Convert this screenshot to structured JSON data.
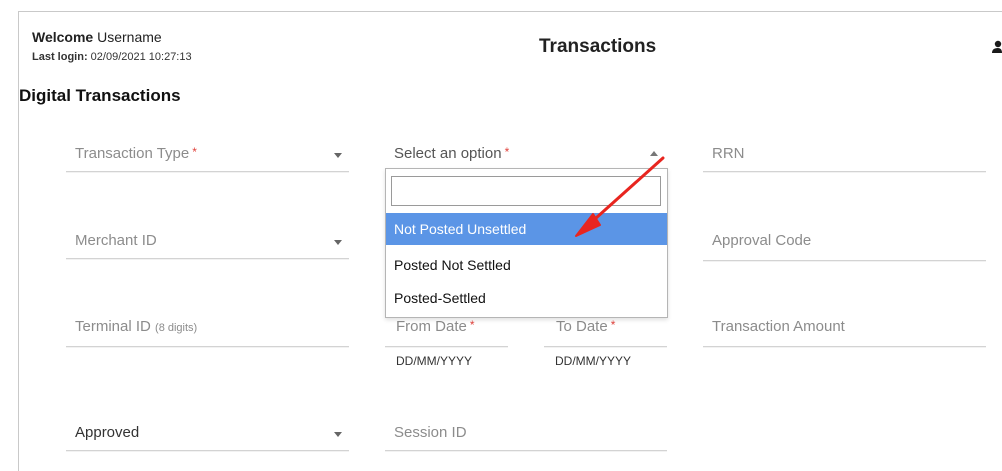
{
  "header": {
    "welcome_bold": "Welcome",
    "username": "Username",
    "last_login_label": "Last login:",
    "last_login_value": "02/09/2021 10:27:13",
    "page_title": "Transactions"
  },
  "section_title": "Digital Transactions",
  "fields": {
    "transaction_type": {
      "label": "Transaction Type",
      "required": "*"
    },
    "status_select": {
      "placeholder": "Select an option",
      "required": "*"
    },
    "rrn": {
      "label": "RRN"
    },
    "merchant_id": {
      "label": "Merchant ID"
    },
    "approval_code": {
      "label": "Approval Code"
    },
    "terminal_id": {
      "label": "Terminal ID",
      "hint": "(8 digits)"
    },
    "from_date": {
      "label": "From Date",
      "required": "*",
      "format": "DD/MM/YYYY"
    },
    "to_date": {
      "label": "To Date",
      "required": "*",
      "format": "DD/MM/YYYY"
    },
    "transaction_amount": {
      "label": "Transaction Amount"
    },
    "approval_status": {
      "value": "Approved"
    },
    "session_id": {
      "label": "Session ID"
    }
  },
  "dropdown": {
    "search_value": "",
    "options": [
      "Not Posted Unsettled",
      "Posted Not Settled",
      "Posted-Settled"
    ],
    "highlighted_index": 0
  },
  "icons": {
    "user": "user-icon",
    "annotation": "red-arrow"
  },
  "colors": {
    "accent": "#5b95e6",
    "required": "#e0423c",
    "focus_border": "#f0a35a",
    "annotation": "#e8251f"
  }
}
